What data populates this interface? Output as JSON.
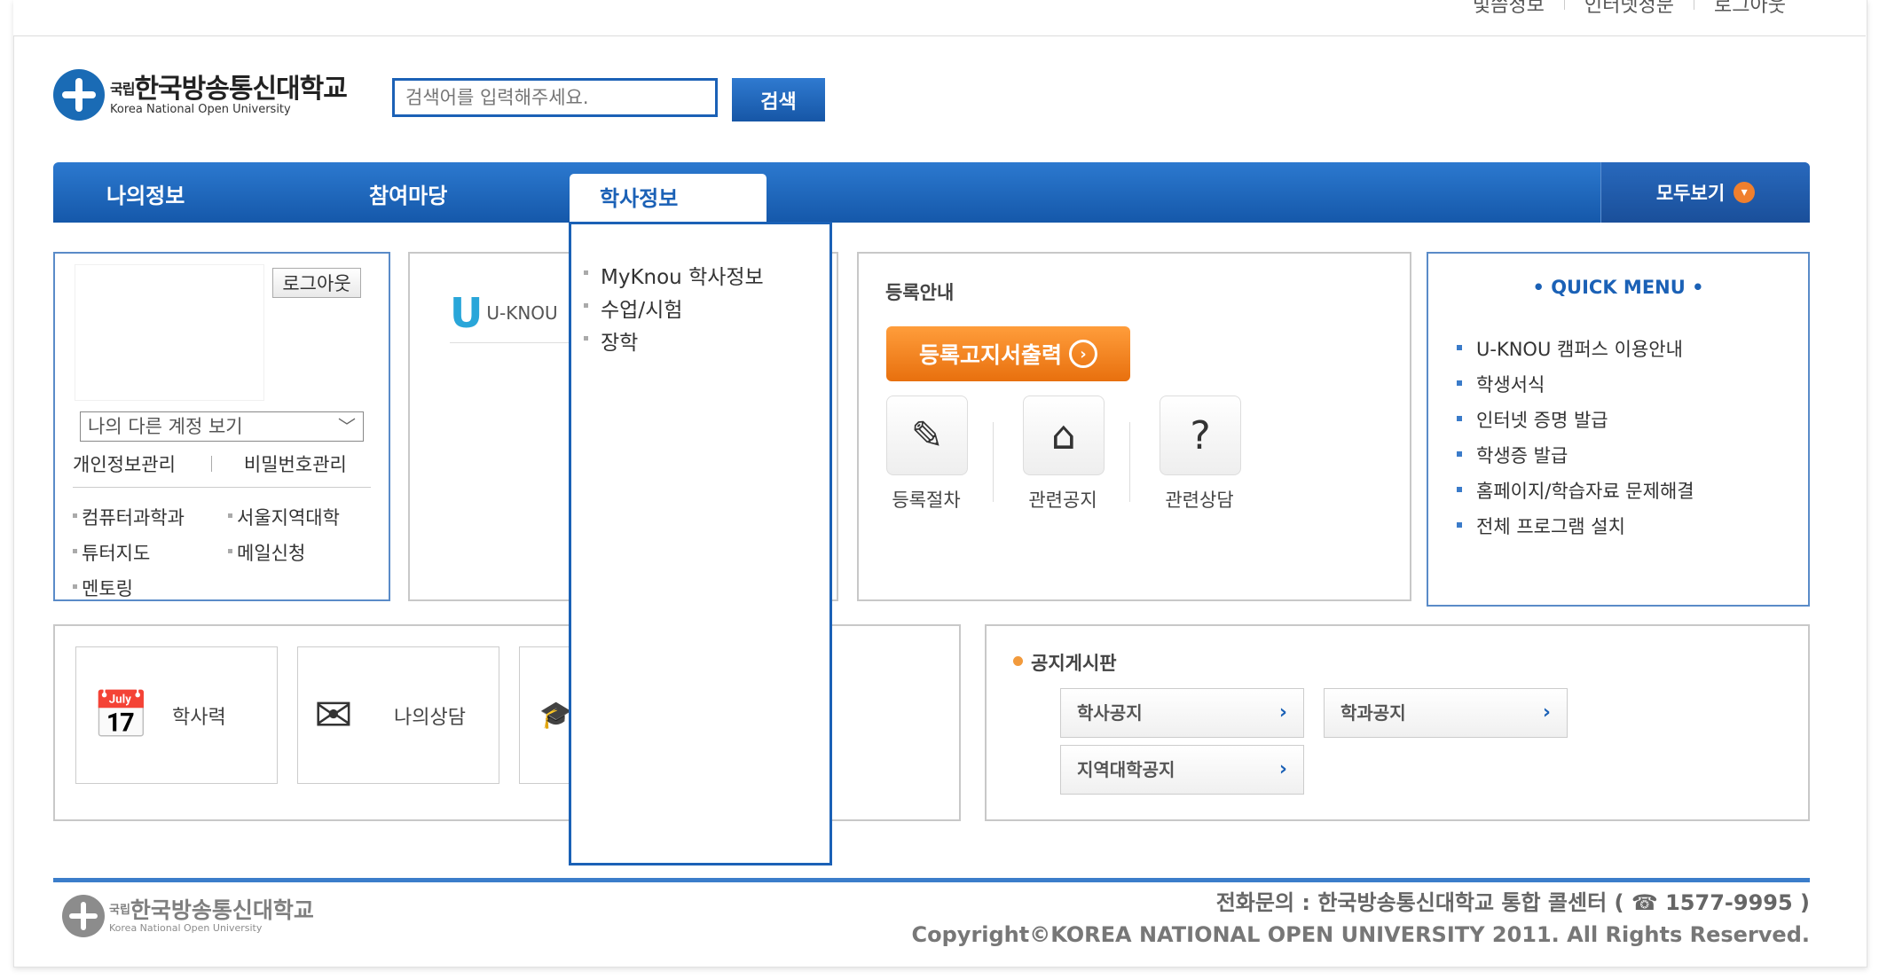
{
  "util_links": [
    "빛씀정보",
    "인터넷정문",
    "로그아웃"
  ],
  "logo": {
    "ko": "한국방송통신대학교",
    "prefix": "국립",
    "en": "Korea National Open University"
  },
  "search": {
    "placeholder": "검색어를 입력해주세요.",
    "button": "검색"
  },
  "nav": {
    "items": [
      "나의정보",
      "참여마당",
      "학사정보"
    ],
    "active": "학사정보",
    "view_all": "모두보기"
  },
  "dropdown": {
    "items": [
      "MyKnou 학사정보",
      "수업/시험",
      "장학"
    ]
  },
  "login": {
    "logout": "로그아웃",
    "account_select": "나의 다른 계정 보기",
    "links": [
      "개인정보관리",
      "비밀번호관리"
    ],
    "quick": [
      "컴퓨터과학과",
      "서울지역대학",
      "튜터지도",
      "메일신청",
      "멘토링"
    ]
  },
  "uknou": {
    "brand": "U-KNOU"
  },
  "registration": {
    "title": "등록안내",
    "print_button": "등록고지서출력",
    "icons": [
      {
        "label": "등록절차",
        "icon": "pencil-document-icon"
      },
      {
        "label": "관련공지",
        "icon": "house-icon"
      },
      {
        "label": "관련상담",
        "icon": "headset-help-icon"
      }
    ]
  },
  "quick_menu": {
    "title": "QUICK MENU",
    "items": [
      "U-KNOU 캠퍼스 이용안내",
      "학생서식",
      "인터넷 증명 발급",
      "학생증 발급",
      "홈페이지/학습자료 문제해결",
      "전체 프로그램 설치"
    ]
  },
  "shortcuts": [
    {
      "label": "학사력",
      "icon": "calendar-clock-icon"
    },
    {
      "label": "나의상담",
      "icon": "letter-quill-icon"
    }
  ],
  "notice": {
    "title": "공지게시판",
    "buttons": [
      "학사공지",
      "학과공지",
      "지역대학공지"
    ]
  },
  "footer": {
    "phone": "전화문의 : 한국방송통신대학교 통합 콜센터 ( ☎ 1577-9995 )",
    "copyright": "Copyright©KOREA NATIONAL OPEN UNIVERSITY 2011. All Rights Reserved."
  }
}
